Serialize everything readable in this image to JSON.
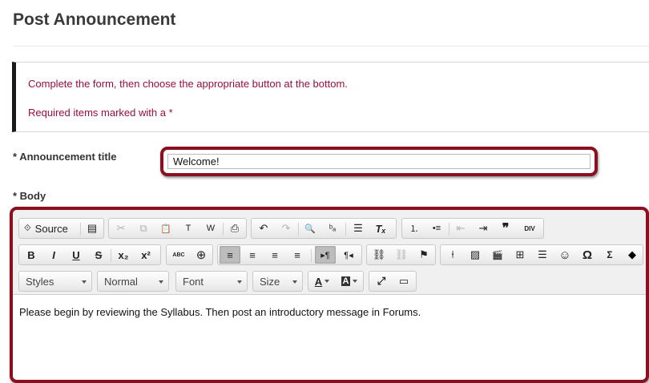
{
  "page": {
    "title": "Post Announcement"
  },
  "instructions": {
    "line1": "Complete the form, then choose the appropriate button at the bottom.",
    "line2": "Required items marked with a *"
  },
  "form": {
    "title_label": "* Announcement title",
    "title_value": "Welcome!",
    "body_label": "* Body"
  },
  "editor": {
    "toolbar_row1": {
      "source_label": "Source",
      "source_icon": "⟐",
      "newpage_icon": "▤",
      "cut_icon": "✂",
      "copy_icon": "⧉",
      "paste_icon": "📋",
      "paste_text_icon": "T",
      "paste_word_icon": "W",
      "print_icon": "⎙",
      "undo_icon": "↶",
      "redo_icon": "↷",
      "find_icon": "🔍",
      "replace_icon": "ᵇₐ",
      "templates_icon": "☰",
      "removeformat_icon": "Tₓ",
      "numlist_icon": "⒈",
      "bullist_icon": "•≡",
      "outdent_icon": "⇤",
      "indent_icon": "⇥",
      "blockquote_icon": "❞",
      "creatediv_icon": "DIV"
    },
    "toolbar_row2": {
      "bold_label": "B",
      "italic_label": "I",
      "underline_label": "U",
      "strike_label": "S",
      "subscript_label": "x₂",
      "superscript_label": "x²",
      "spellcheck_icon": "ABC",
      "accessibility_icon": "⊕",
      "align_left_icon": "≡",
      "align_center_icon": "≡",
      "align_right_icon": "≡",
      "justify_icon": "≡",
      "ltr_icon": "▸¶",
      "rtl_icon": "¶◂",
      "link_icon": "⛓",
      "unlink_icon": "⛓",
      "anchor_icon": "⚑",
      "ruler_icon": "⍿",
      "image_icon": "▨",
      "video_icon": "🎬",
      "table_icon": "⊞",
      "hr_icon": "☰",
      "smiley_icon": "☺",
      "specialchar_label": "Ω",
      "math_label": "Σ",
      "flash_icon": "◆"
    },
    "toolbar_row3": {
      "styles_label": "Styles",
      "format_label": "Normal",
      "font_label": "Font",
      "size_label": "Size",
      "textcolor_label": "A",
      "bgcolor_label": "A",
      "maximize_icon": "⤢",
      "blocks_icon": "▭"
    },
    "content": "Please begin by reviewing the Syllabus. Then post an introductory message in Forums."
  },
  "colors": {
    "accent": "#990d3d",
    "highlight_border": "#8c0f1f"
  }
}
